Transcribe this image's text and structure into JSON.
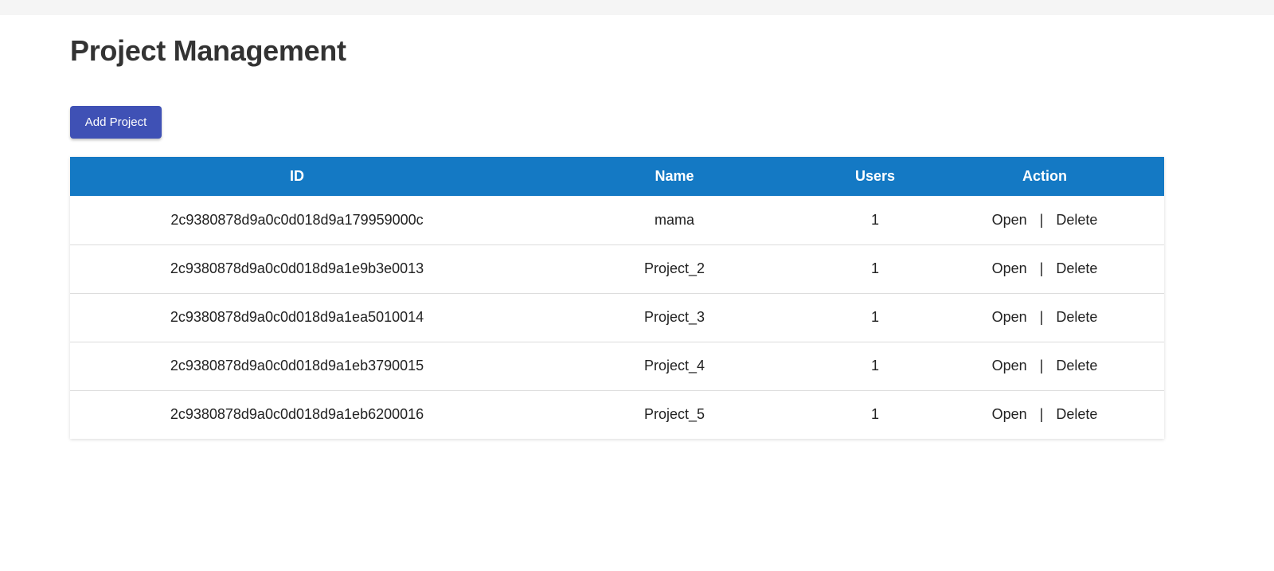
{
  "page": {
    "title": "Project Management",
    "add_button_label": "Add Project"
  },
  "table": {
    "columns": [
      "ID",
      "Name",
      "Users",
      "Action"
    ],
    "rows": [
      {
        "id": "2c9380878d9a0c0d018d9a179959000c",
        "name": "mama",
        "users": "1"
      },
      {
        "id": "2c9380878d9a0c0d018d9a1e9b3e0013",
        "name": "Project_2",
        "users": "1"
      },
      {
        "id": "2c9380878d9a0c0d018d9a1ea5010014",
        "name": "Project_3",
        "users": "1"
      },
      {
        "id": "2c9380878d9a0c0d018d9a1eb3790015",
        "name": "Project_4",
        "users": "1"
      },
      {
        "id": "2c9380878d9a0c0d018d9a1eb6200016",
        "name": "Project_5",
        "users": "1"
      }
    ],
    "actions": {
      "open_label": "Open",
      "separator": "|",
      "delete_label": "Delete"
    }
  },
  "colors": {
    "header_bg": "#1479c4",
    "button_bg": "#3f51b5",
    "title_text": "#333333"
  }
}
